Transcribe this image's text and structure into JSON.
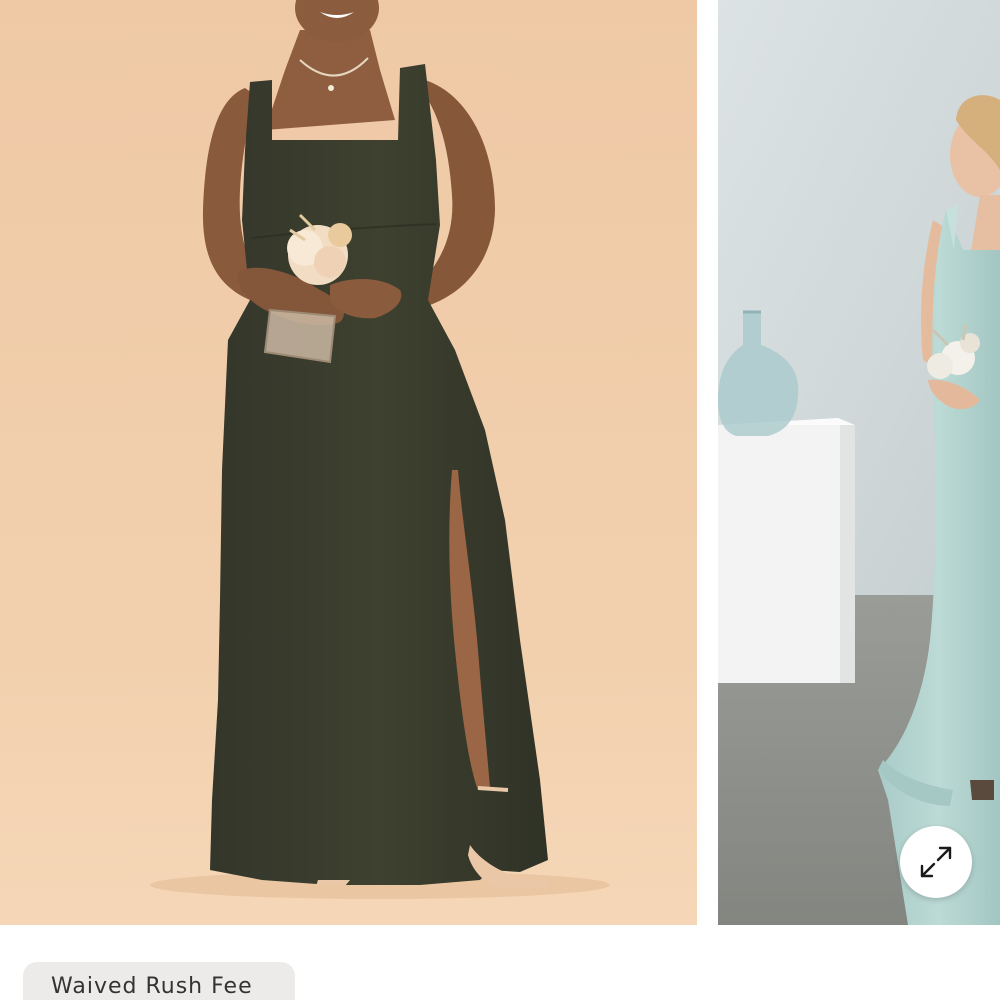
{
  "gallery": {
    "slides": [
      {
        "icon": "photo-olive-gown-model"
      },
      {
        "icon": "photo-sage-gown-model"
      }
    ],
    "expand_icon": "expand-arrows-icon"
  },
  "badge": {
    "label": "Waived Rush Fee"
  },
  "colors": {
    "slide1_background": "#f1cfae",
    "dress_olive": "#3b3d2c",
    "slide2_wall": "#d4dcdc",
    "slide2_floor": "#8f918d",
    "dress_sage": "#b3d3cf",
    "badge_background": "#ecebe9"
  }
}
